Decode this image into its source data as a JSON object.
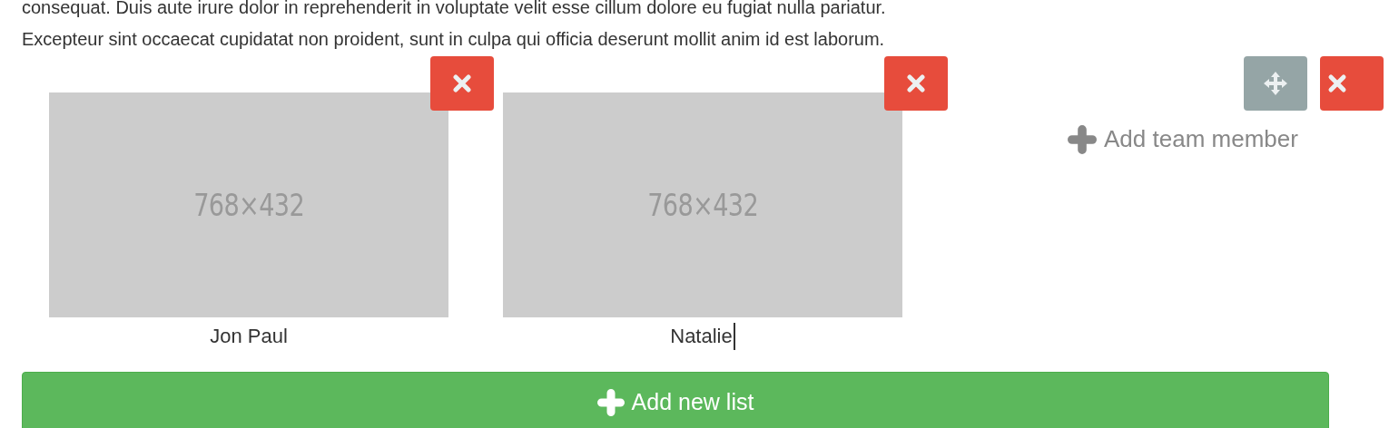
{
  "paragraph_lines": [
    "consequat. Duis aute irure dolor in reprehenderit in voluptate velit esse cillum dolore eu fugiat nulla pariatur.",
    "Excepteur sint occaecat cupidatat non proident, sunt in culpa qui officia deserunt mollit anim id est laborum."
  ],
  "team_members": [
    {
      "placeholder_text": "768×432",
      "name": "Jon Paul",
      "editing": false
    },
    {
      "placeholder_text": "768×432",
      "name": "Natalie",
      "editing": true
    }
  ],
  "add_member_label": "Add team member",
  "add_list_button": "Add new list"
}
